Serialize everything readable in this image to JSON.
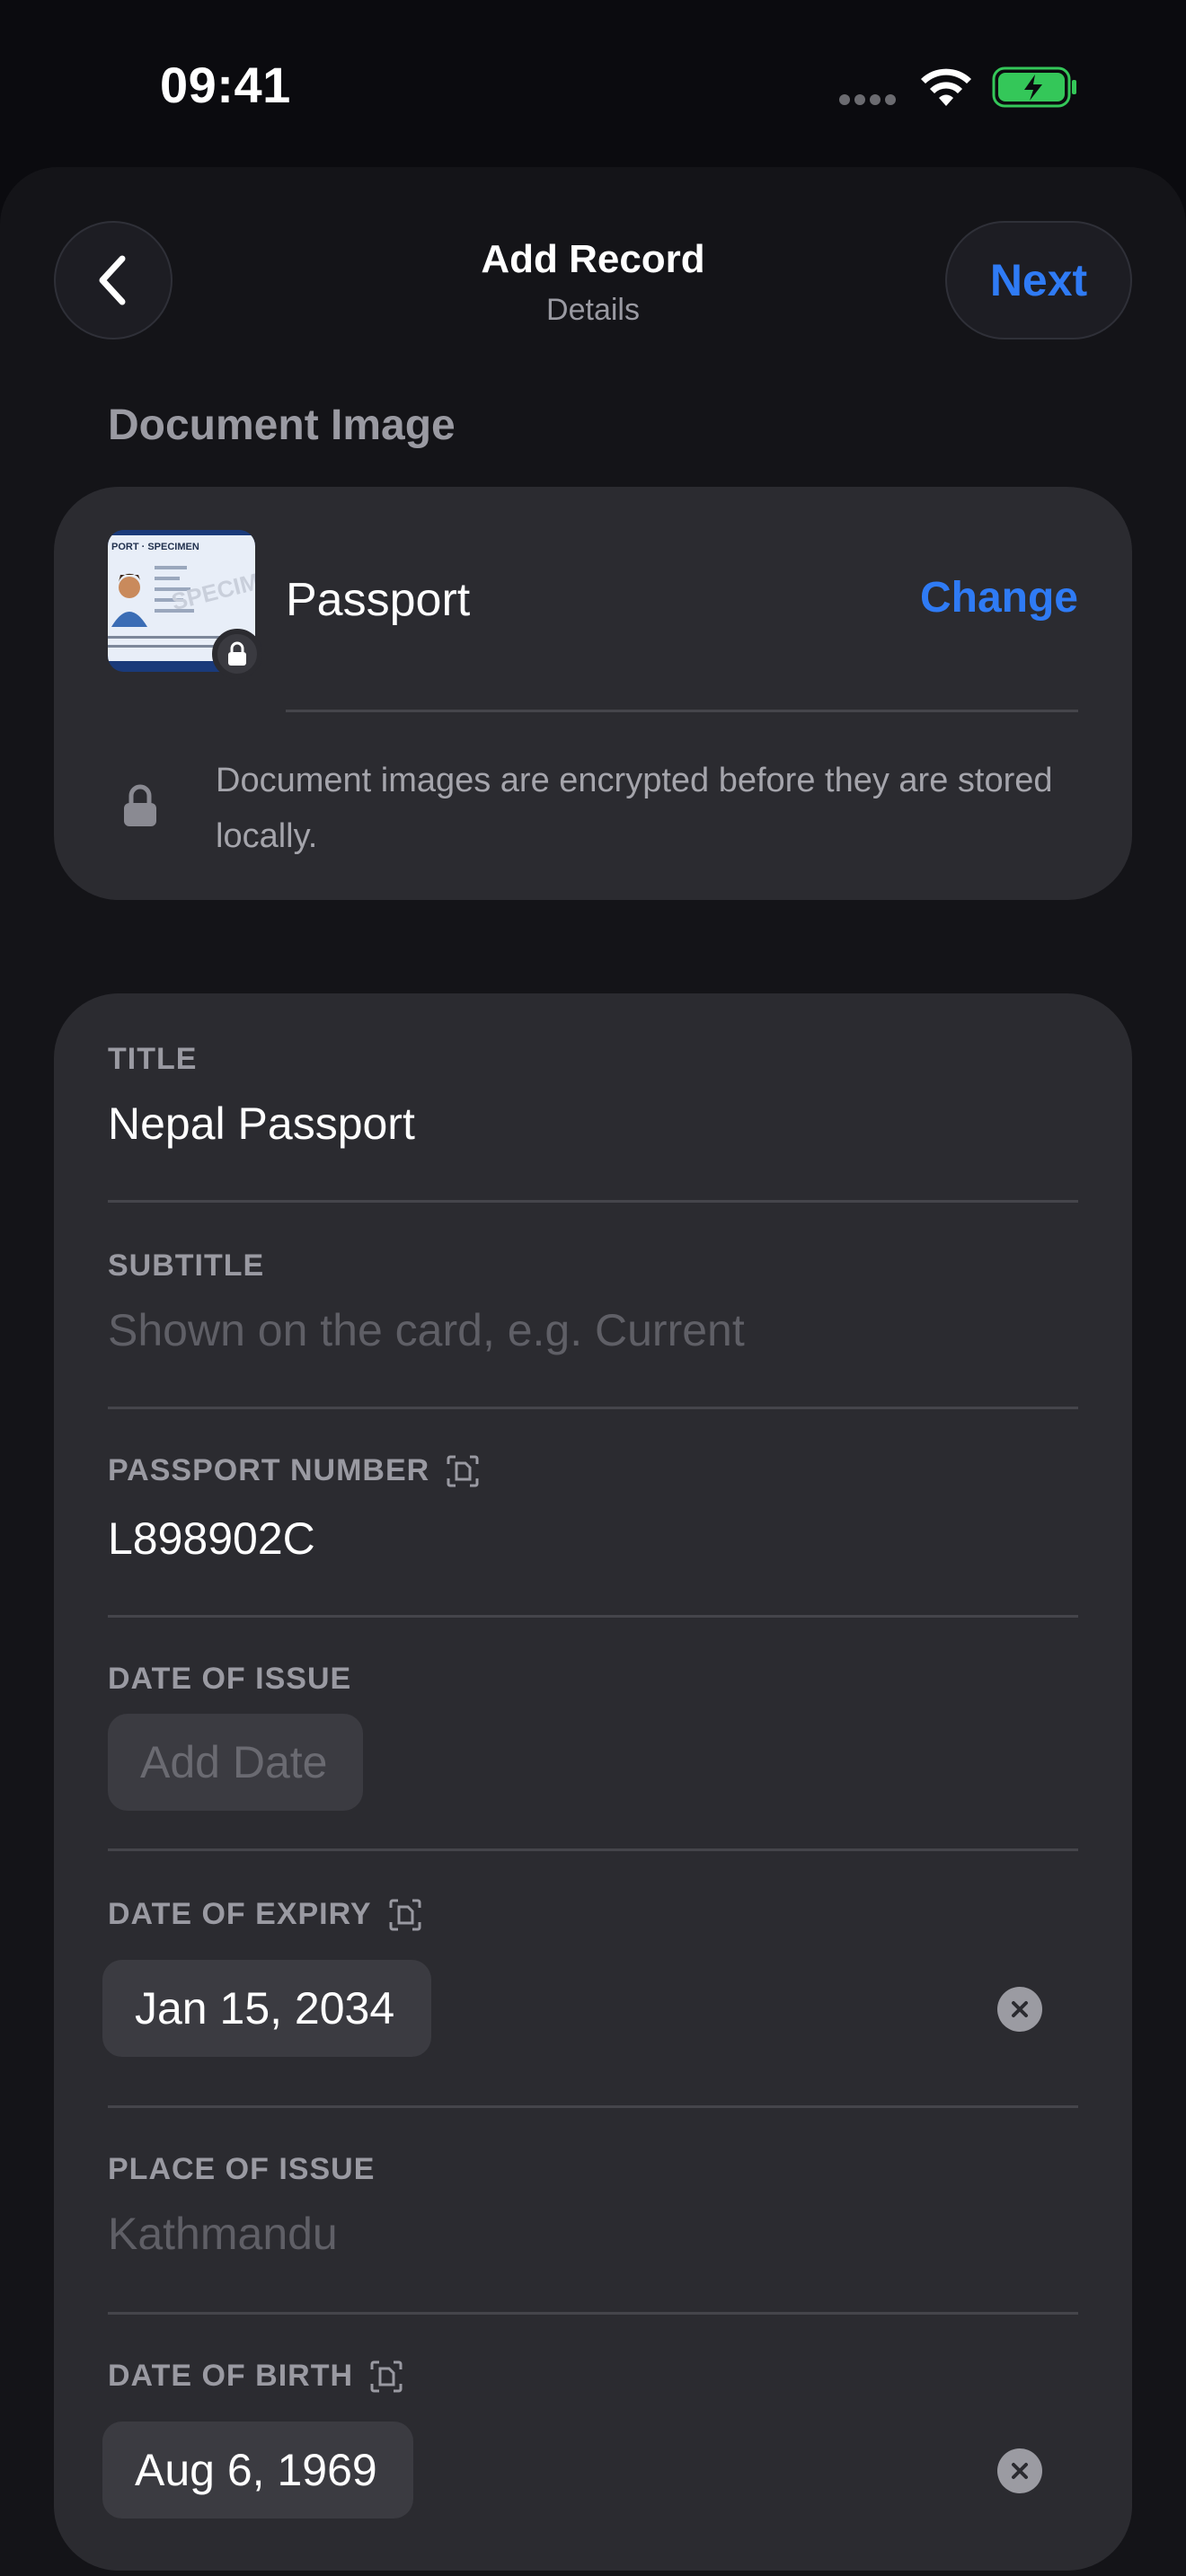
{
  "status_bar": {
    "time": "09:41"
  },
  "nav": {
    "title": "Add Record",
    "subtitle": "Details",
    "next_label": "Next"
  },
  "document_image": {
    "header": "Document Image",
    "name": "Passport",
    "change_label": "Change",
    "encryption_note": "Document images are encrypted before they are stored locally.",
    "thumbnail_text": "PORT · SPECIMEN",
    "thumbnail_watermark": "SPECIMEN"
  },
  "form": {
    "title": {
      "label": "TITLE",
      "value": "Nepal Passport"
    },
    "subtitle": {
      "label": "SUBTITLE",
      "placeholder": "Shown on the card, e.g. Current"
    },
    "passport_number": {
      "label": "PASSPORT NUMBER",
      "value": "L898902C"
    },
    "date_of_issue": {
      "label": "DATE OF ISSUE",
      "placeholder": "Add Date"
    },
    "date_of_expiry": {
      "label": "DATE OF EXPIRY",
      "value": "Jan 15, 2034"
    },
    "place_of_issue": {
      "label": "PLACE OF ISSUE",
      "placeholder": "Kathmandu"
    },
    "date_of_birth": {
      "label": "DATE OF BIRTH",
      "value": "Aug 6, 1969"
    }
  },
  "colors": {
    "accent": "#2f7bf5",
    "battery": "#34c759",
    "card": "#2b2b30"
  },
  "icons": [
    "back-chevron-icon",
    "lock-icon",
    "scan-icon",
    "clear-icon",
    "wifi-icon",
    "battery-icon",
    "cellular-icon"
  ]
}
